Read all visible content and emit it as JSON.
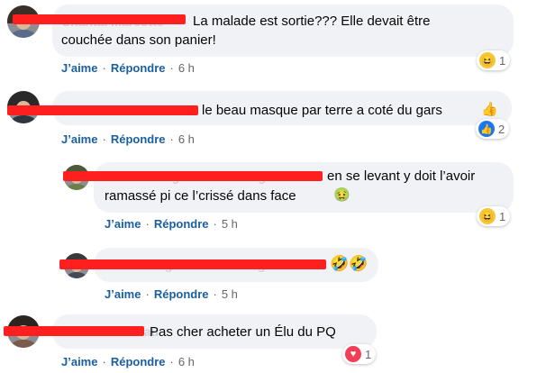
{
  "comments": [
    {
      "name_hidden": "Chantal Marcotte",
      "text": "La malade est sortie??? Elle devait être",
      "text2": "couchée dans son panier!",
      "like": "J’aime",
      "reply": "Répondre",
      "time": "6 h",
      "reaction_count": "1",
      "reaction_icon": "haha-icon"
    },
    {
      "text": "le beau masque par terre a coté du gars",
      "like": "J’aime",
      "reply": "Répondre",
      "time": "6 h",
      "reaction_count": "2",
      "reaction_icon": "like-icon"
    },
    {
      "name_hidden": "Alain Rodrigue Eric Rodrigue",
      "text": "en se levant y doit l’avoir",
      "text2": "ramassé pi ce l’crissé dans face",
      "like": "J’aime",
      "reply": "Répondre",
      "time": "5 h",
      "reaction_count": "1",
      "reaction_icon": "haha-icon"
    },
    {
      "name_hidden": "Eric Rodrigue Alain Rodrigue",
      "like": "J’aime",
      "reply": "Répondre",
      "time": "5 h"
    },
    {
      "name_hidden": "Gilles Martineau",
      "text": "Pas cher acheter un Élu du PQ",
      "like": "J’aime",
      "reply": "Répondre",
      "time": "6 h",
      "reaction_count": "1",
      "reaction_icon": "love-icon"
    }
  ],
  "colors": {
    "link": "#1a5fa0",
    "bubble": "#f0f2f5",
    "redaction": "#ff1f1f",
    "meta": "#65676b"
  }
}
